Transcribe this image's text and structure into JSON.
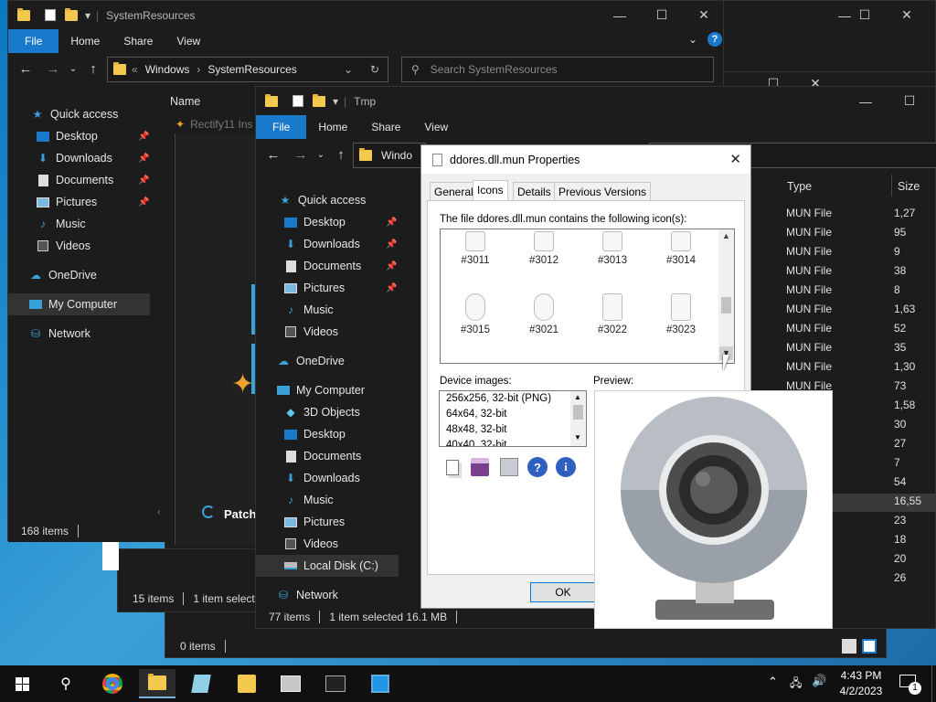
{
  "win1": {
    "title": "SystemResources",
    "ribbon": [
      "File",
      "Home",
      "Share",
      "View"
    ],
    "breadcrumb": [
      "Windows",
      "SystemResources"
    ],
    "search_placeholder": "Search SystemResources",
    "column_name": "Name",
    "file_peek": "Rectify11 Ins",
    "patch_text": "Patch",
    "nav": [
      "Quick access",
      "Desktop",
      "Downloads",
      "Documents",
      "Pictures",
      "Music",
      "Videos",
      "OneDrive",
      "My Computer",
      "Network"
    ],
    "status_count": "168 items"
  },
  "win3": {
    "status_count": "15 items",
    "status_selected": "1 item selecte"
  },
  "win4": {
    "status_count": "0 items"
  },
  "win2": {
    "title": "Tmp",
    "ribbon": [
      "File",
      "Home",
      "Share",
      "View"
    ],
    "breadcrumb": "Windo",
    "nav": [
      "Quick access",
      "Desktop",
      "Downloads",
      "Documents",
      "Pictures",
      "Music",
      "Videos",
      "OneDrive",
      "My Computer",
      "3D Objects",
      "Desktop",
      "Documents",
      "Downloads",
      "Music",
      "Pictures",
      "Videos",
      "Local Disk (C:)",
      "Network"
    ],
    "columns": {
      "type": "Type",
      "size": "Size"
    },
    "rows": [
      {
        "type": "MUN File",
        "size": "1,27"
      },
      {
        "type": "MUN File",
        "size": "95"
      },
      {
        "type": "MUN File",
        "size": "9"
      },
      {
        "type": "MUN File",
        "size": "38"
      },
      {
        "type": "MUN File",
        "size": "8"
      },
      {
        "type": "MUN File",
        "size": "1,63"
      },
      {
        "type": "MUN File",
        "size": "52"
      },
      {
        "type": "MUN File",
        "size": "35"
      },
      {
        "type": "MUN File",
        "size": "1,30"
      },
      {
        "type": "MUN File",
        "size": "73"
      }
    ],
    "extra_sizes": [
      "1,58",
      "30",
      "27",
      "7",
      "54",
      "16,55",
      "23",
      "18",
      "20",
      "26"
    ],
    "status_count": "77 items",
    "status_selected": "1 item selected  16.1 MB"
  },
  "dialog": {
    "title": "ddores.dll.mun Properties",
    "tabs": [
      "General",
      "Icons",
      "Details",
      "Previous Versions"
    ],
    "description": "The file ddores.dll.mun contains the following icon(s):",
    "icons_row1": [
      "#3011",
      "#3012",
      "#3013",
      "#3014"
    ],
    "icons_row2": [
      "#3015",
      "#3021",
      "#3022",
      "#3023"
    ],
    "device_images_label": "Device images:",
    "device_images": [
      "256x256, 32-bit (PNG)",
      "64x64, 32-bit",
      "48x48, 32-bit",
      "40x40, 32-bit"
    ],
    "preview_label": "Preview:",
    "ok_label": "OK"
  },
  "taskbar": {
    "time": "4:43 PM",
    "date": "4/2/2023",
    "notification_count": "1"
  },
  "colors": {
    "accent": "#1979ca",
    "dark_bg": "#1c1c1c",
    "folder": "#f2c94c"
  }
}
